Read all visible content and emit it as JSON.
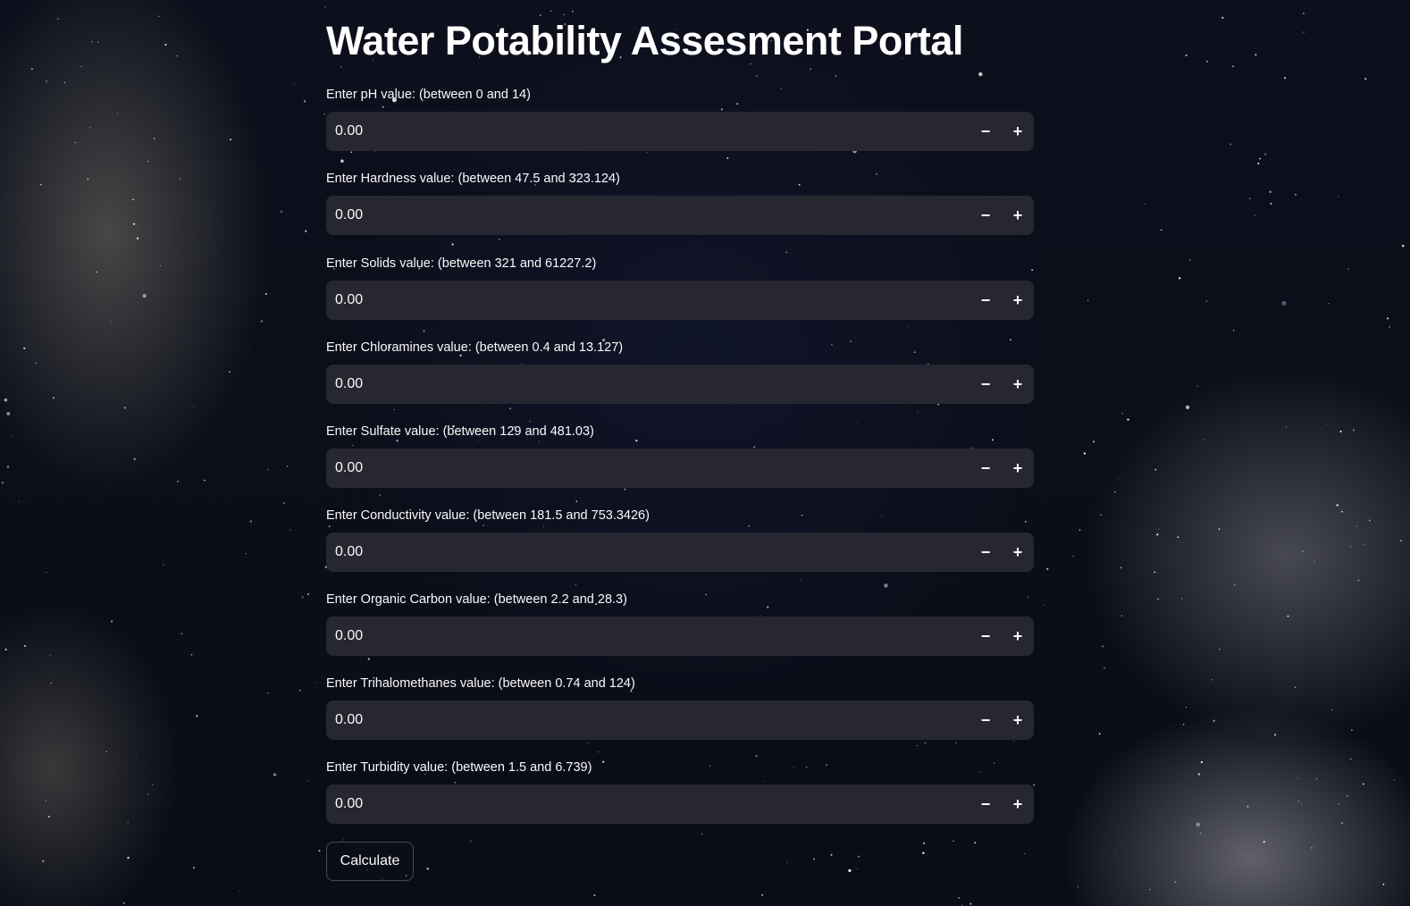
{
  "page": {
    "title": "Water Potability Assesment Portal"
  },
  "form": {
    "fields": [
      {
        "label": "Enter pH value: (between 0 and 14)",
        "value": "0.00"
      },
      {
        "label": "Enter Hardness value: (between 47.5 and 323.124)",
        "value": "0.00"
      },
      {
        "label": "Enter Solids value: (between 321 and 61227.2)",
        "value": "0.00"
      },
      {
        "label": "Enter Chloramines value: (between 0.4 and 13.127)",
        "value": "0.00"
      },
      {
        "label": "Enter Sulfate value: (between 129 and 481.03)",
        "value": "0.00"
      },
      {
        "label": "Enter Conductivity value: (between 181.5 and 753.3426)",
        "value": "0.00"
      },
      {
        "label": "Enter Organic Carbon value: (between 2.2 and 28.3)",
        "value": "0.00"
      },
      {
        "label": "Enter Trihalomethanes value: (between 0.74 and 124)",
        "value": "0.00"
      },
      {
        "label": "Enter Turbidity value: (between 1.5 and 6.739)",
        "value": "0.00"
      }
    ],
    "stepper": {
      "minus_symbol": "−",
      "plus_symbol": "+"
    },
    "calculate_label": "Calculate"
  },
  "colors": {
    "input_background": "#262730",
    "text": "#fafafa",
    "background": "#0b0d18"
  }
}
